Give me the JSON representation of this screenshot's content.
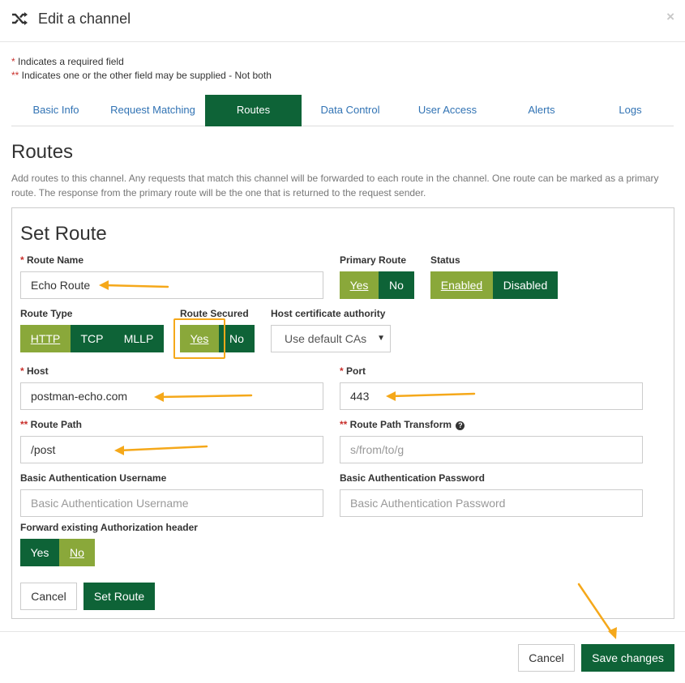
{
  "header": {
    "title": "Edit a channel",
    "close_label": "×"
  },
  "legend": {
    "required_star": "*",
    "required_text": " Indicates a required field",
    "either_star": "**",
    "either_text": " Indicates one or the other field may be supplied - Not both"
  },
  "tabs": [
    {
      "label": "Basic Info"
    },
    {
      "label": "Request Matching"
    },
    {
      "label": "Routes",
      "active": true
    },
    {
      "label": "Data Control"
    },
    {
      "label": "User Access"
    },
    {
      "label": "Alerts"
    },
    {
      "label": "Logs"
    }
  ],
  "section": {
    "title": "Routes",
    "description": "Add routes to this channel. Any requests that match this channel will be forwarded to each route in the channel. One route can be marked as a primary route. The response from the primary route will be the one that is returned to the request sender."
  },
  "form": {
    "title": "Set Route",
    "route_name": {
      "star": "*",
      "label": " Route Name",
      "value": "Echo Route"
    },
    "primary_route": {
      "label": "Primary Route",
      "yes": "Yes",
      "no": "No",
      "selected": "Yes"
    },
    "status": {
      "label": "Status",
      "enabled": "Enabled",
      "disabled": "Disabled",
      "selected": "Enabled"
    },
    "route_type": {
      "label": "Route Type",
      "options": [
        "HTTP",
        "TCP",
        "MLLP"
      ],
      "selected": "HTTP"
    },
    "route_secured": {
      "label": "Route Secured",
      "yes": "Yes",
      "no": "No",
      "selected": "Yes"
    },
    "host_ca": {
      "label": "Host certificate authority",
      "value": "Use default CAs",
      "caret": "▼"
    },
    "host": {
      "star": "*",
      "label": " Host",
      "value": "postman-echo.com"
    },
    "port": {
      "star": "*",
      "label": " Port",
      "value": "443"
    },
    "route_path": {
      "star": "**",
      "label": " Route Path",
      "value": "/post"
    },
    "route_path_transform": {
      "star": "**",
      "label": " Route Path Transform",
      "placeholder": "s/from/to/g",
      "help_icon": "?"
    },
    "basic_auth_username": {
      "label": "Basic Authentication Username",
      "placeholder": "Basic Authentication Username"
    },
    "basic_auth_password": {
      "label": "Basic Authentication Password",
      "placeholder": "Basic Authentication Password"
    },
    "forward_auth": {
      "label": "Forward existing Authorization header",
      "yes": "Yes",
      "no": "No",
      "selected": "No"
    },
    "cancel_label": "Cancel",
    "set_route_label": "Set Route"
  },
  "footer": {
    "cancel_label": "Cancel",
    "save_label": "Save changes"
  },
  "colors": {
    "brand_green": "#0e6337",
    "selected_olive": "#8aa83a",
    "link_blue": "#3173b4",
    "required_red": "#c9302c",
    "annotation_orange": "#f5a81a"
  }
}
